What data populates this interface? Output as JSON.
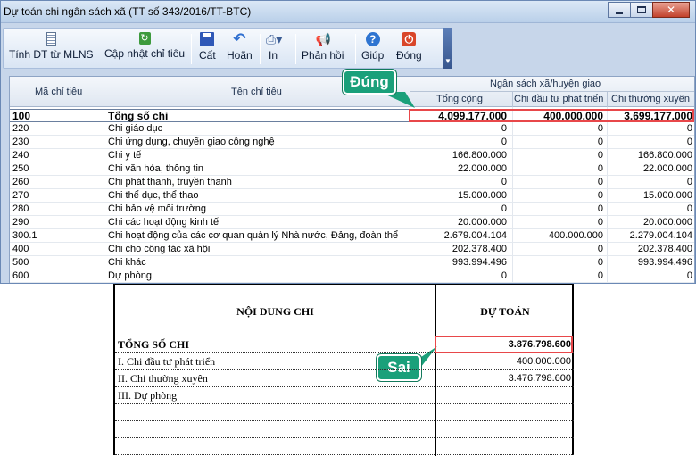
{
  "window": {
    "title": "Dự toán chi ngân sách xã (TT số 343/2016/TT-BTC)"
  },
  "toolbar": {
    "buttons": [
      {
        "label": "Tính DT từ MLNS",
        "icon": "document-icon"
      },
      {
        "label": "Cập nhật chỉ tiêu",
        "icon": "refresh-icon"
      },
      {
        "label": "Cất",
        "icon": "save-icon"
      },
      {
        "label": "Hoãn",
        "icon": "undo-icon"
      },
      {
        "label": "In",
        "icon": "print-icon"
      },
      {
        "label": "Phản hồi",
        "icon": "megaphone-icon"
      },
      {
        "label": "Giúp",
        "icon": "help-icon"
      },
      {
        "label": "Đóng",
        "icon": "close-icon"
      }
    ]
  },
  "grid": {
    "headers": {
      "code": "Mã chỉ tiêu",
      "name": "Tên chỉ tiêu",
      "group": "Ngân sách xã/huyện giao",
      "total": "Tổng cộng",
      "invest": "Chi đầu tư phát triển",
      "regular": "Chi thường xuyên"
    },
    "rows": [
      {
        "code": "100",
        "name": "Tổng số chi",
        "total": "4.099.177.000",
        "invest": "400.000.000",
        "regular": "3.699.177.000"
      },
      {
        "code": "220",
        "name": "Chi giáo dục",
        "total": "0",
        "invest": "0",
        "regular": "0"
      },
      {
        "code": "230",
        "name": "Chi ứng dụng, chuyển giao công nghệ",
        "total": "0",
        "invest": "0",
        "regular": "0"
      },
      {
        "code": "240",
        "name": "Chi y tế",
        "total": "166.800.000",
        "invest": "0",
        "regular": "166.800.000"
      },
      {
        "code": "250",
        "name": "Chi văn hóa, thông tin",
        "total": "22.000.000",
        "invest": "0",
        "regular": "22.000.000"
      },
      {
        "code": "260",
        "name": "Chi phát thanh, truyền thanh",
        "total": "0",
        "invest": "0",
        "regular": "0"
      },
      {
        "code": "270",
        "name": "Chi thể dục, thể thao",
        "total": "15.000.000",
        "invest": "0",
        "regular": "15.000.000"
      },
      {
        "code": "280",
        "name": "Chi bảo vệ môi trường",
        "total": "0",
        "invest": "0",
        "regular": "0"
      },
      {
        "code": "290",
        "name": "Chi các hoạt động kinh tế",
        "total": "20.000.000",
        "invest": "0",
        "regular": "20.000.000"
      },
      {
        "code": "300.1",
        "name": "Chi hoạt động của các cơ quan quản lý Nhà nước, Đảng, đoàn thể",
        "total": "2.679.004.104",
        "invest": "400.000.000",
        "regular": "2.279.004.104"
      },
      {
        "code": "400",
        "name": "Chi cho công tác xã hội",
        "total": "202.378.400",
        "invest": "0",
        "regular": "202.378.400"
      },
      {
        "code": "500",
        "name": "Chi khác",
        "total": "993.994.496",
        "invest": "0",
        "regular": "993.994.496"
      },
      {
        "code": "600",
        "name": "Dự phòng",
        "total": "0",
        "invest": "0",
        "regular": "0"
      }
    ]
  },
  "callouts": {
    "correct": "Đúng",
    "wrong": "Sai"
  },
  "report": {
    "col_content": "NỘI DUNG CHI",
    "col_estimate": "DỰ TOÁN",
    "rows": [
      {
        "label": "TỔNG SỐ CHI",
        "value": "3.876.798.600"
      },
      {
        "label": "I. Chi đầu tư phát triển",
        "value": "400.000.000"
      },
      {
        "label": "II. Chi thường xuyên",
        "value": "3.476.798.600"
      },
      {
        "label": "III. Dự phòng",
        "value": ""
      },
      {
        "label": "",
        "value": ""
      },
      {
        "label": "",
        "value": ""
      },
      {
        "label": "",
        "value": ""
      }
    ]
  },
  "colors": {
    "highlight_red": "#e8474a",
    "callout_green": "#1aa07a",
    "window_blue": "#c7d6ea"
  }
}
